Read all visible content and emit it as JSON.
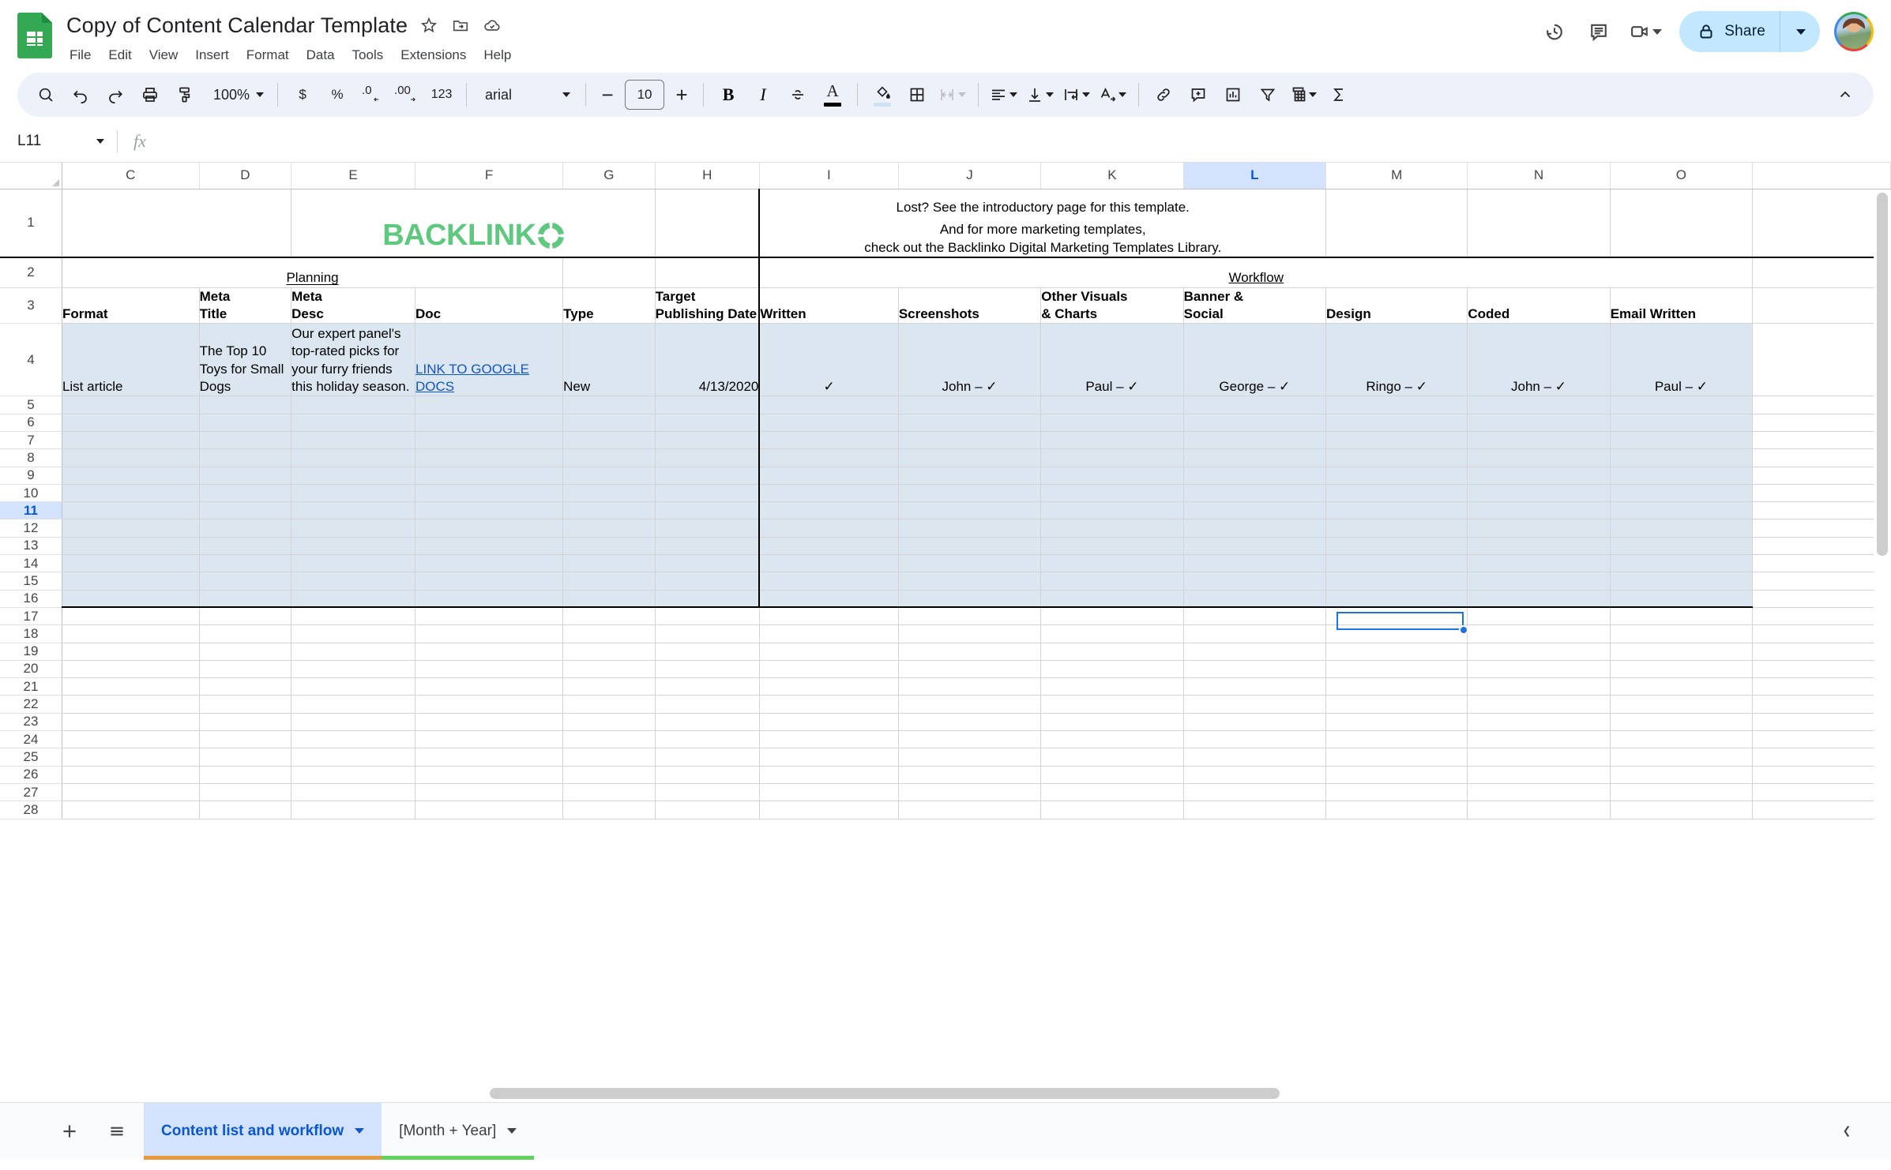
{
  "app": {
    "doc_title": "Copy of Content Calendar Template",
    "logo_name": "google-sheets-logo"
  },
  "title_icons": [
    {
      "name": "star-icon",
      "label": "Star"
    },
    {
      "name": "move-to-folder-icon",
      "label": "Move"
    },
    {
      "name": "cloud-saved-icon",
      "label": "Saved to Drive"
    }
  ],
  "menubar": [
    "File",
    "Edit",
    "View",
    "Insert",
    "Format",
    "Data",
    "Tools",
    "Extensions",
    "Help"
  ],
  "header_right": {
    "history_icon": "version-history-icon",
    "comment_icon": "comment-icon",
    "meet_icon": "meet-camera-icon",
    "share_label": "Share",
    "share_lock_icon": "lock-icon",
    "avatar_name": "user-avatar"
  },
  "toolbar": {
    "search_icon": "search-icon",
    "undo_icon": "undo-icon",
    "redo_icon": "redo-icon",
    "print_icon": "print-icon",
    "paint_format_icon": "paint-format-icon",
    "zoom_value": "100%",
    "currency_label": "$",
    "percent_label": "%",
    "decimal_decrease_label": ".0",
    "decimal_increase_label": ".00",
    "number_format_label": "123",
    "font_name": "arial",
    "font_size": "10",
    "decrease_size_label": "−",
    "increase_size_label": "+",
    "bold_label": "B",
    "italic_label": "I",
    "strikethrough_icon": "strikethrough-icon",
    "text_color_label": "A",
    "text_color_swatch": "#000000",
    "fill_color_icon": "fill-color-icon",
    "fill_color_swatch": "#cfe2f3",
    "borders_icon": "borders-icon",
    "merge_icon": "merge-cells-icon",
    "align_icon": "horizontal-align-icon",
    "valign_icon": "vertical-align-icon",
    "wrap_icon": "text-wrap-icon",
    "rotate_icon": "text-rotation-icon",
    "link_icon": "insert-link-icon",
    "comment_icon": "insert-comment-icon",
    "chart_icon": "insert-chart-icon",
    "filter_icon": "create-filter-icon",
    "functions_icon": "functions-icon",
    "pivot_icon": "pivot-table-icon",
    "collapse_icon": "collapse-toolbar-icon"
  },
  "formula_bar": {
    "name_box": "L11",
    "fx_label": "fx",
    "formula_value": ""
  },
  "grid": {
    "columns": [
      "C",
      "D",
      "E",
      "F",
      "G",
      "H",
      "I",
      "J",
      "K",
      "L",
      "M",
      "N",
      "O"
    ],
    "selected_column": "L",
    "selected_row": 11,
    "selected_cell": "L11",
    "row_numbers": [
      1,
      2,
      3,
      4,
      5,
      6,
      7,
      8,
      9,
      10,
      11,
      12,
      13,
      14,
      15,
      16,
      17,
      18,
      19,
      20,
      21,
      22,
      23,
      24,
      25,
      26,
      27,
      28
    ]
  },
  "banner": {
    "logo_text": "BACKLINK",
    "logo_color": "#5ec87f",
    "background_color": "#e8973c",
    "message_line1": "Lost? See the introductory page for this template.",
    "message_line2": "And for more marketing templates,",
    "message_line3": "check out the Backlinko Digital Marketing Templates Library."
  },
  "section_headers": {
    "planning": "Planning",
    "workflow": "Workflow",
    "planning_color": "#f7d67a",
    "workflow_color": "#fdeec8"
  },
  "column_headers": {
    "C": "Format",
    "D_line1": "Meta",
    "D_line2": "Title",
    "E_line1": "Meta",
    "E_line2": "Desc",
    "F": "Doc",
    "G": "Type",
    "H_line1": "Target",
    "H_line2": "Publishing Date",
    "I": "Written",
    "J": "Screenshots",
    "K_line1": "Other Visuals",
    "K_line2": "& Charts",
    "L_line1": "Banner &",
    "L_line2": "Social",
    "M": "Design",
    "N": "Coded",
    "O": "Email Written"
  },
  "data_row": {
    "format": "List article",
    "meta_title": "The Top 10 Toys for Small Dogs",
    "meta_desc": "Our expert panel's top-rated picks for your furry friends this holiday season.",
    "doc_link": "LINK TO GOOGLE DOCS",
    "type": "New",
    "target_date": "4/13/2020",
    "written": "✓",
    "screenshots": "John – ✓",
    "other_visuals": "Paul – ✓",
    "banner_social": "George –  ✓",
    "design": "Ringo – ✓",
    "coded": "John – ✓",
    "email_written": "Paul – ✓"
  },
  "bottom_bar": {
    "add_sheet_icon": "add-sheet-icon",
    "all_sheets_icon": "all-sheets-icon",
    "tabs": [
      {
        "label": "Content list and workflow",
        "active": true,
        "underline_color": "#e8973c"
      },
      {
        "label": "[Month + Year]",
        "active": false,
        "underline_color": "#5fd35f"
      }
    ],
    "explore_icon": "explore-icon"
  }
}
